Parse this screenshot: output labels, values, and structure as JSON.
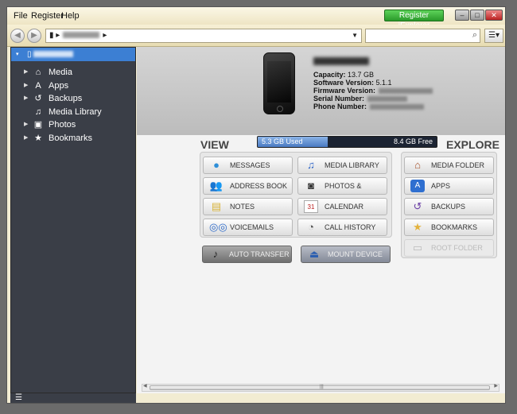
{
  "menu": {
    "file": "File",
    "register": "Register",
    "help": "Help"
  },
  "titlebar": {
    "register_button": "Register iExplorer",
    "minimize": "–",
    "maximize": "□",
    "close": "✕"
  },
  "toolbar": {
    "back": "◀",
    "forward": "▶",
    "search_placeholder": "",
    "search_icon": "⌕",
    "view_menu": "☰▾"
  },
  "sidebar": {
    "items": [
      {
        "label": "Media",
        "icon": "home-icon"
      },
      {
        "label": "Apps",
        "icon": "apps-icon"
      },
      {
        "label": "Backups",
        "icon": "backup-icon"
      },
      {
        "label": "Media Library",
        "icon": "music-note-icon"
      },
      {
        "label": "Photos",
        "icon": "photo-icon"
      },
      {
        "label": "Bookmarks",
        "icon": "star-icon"
      }
    ],
    "footer_icon": "☰"
  },
  "device": {
    "capacity_label": "Capacity:",
    "capacity_value": "13.7 GB",
    "software_label": "Software Version:",
    "software_value": "5.1.1",
    "firmware_label": "Firmware Version:",
    "serial_label": "Serial Number:",
    "phone_label": "Phone Number:"
  },
  "storage": {
    "used": "5.3 GB Used",
    "free": "8.4 GB Free",
    "used_fraction": 0.39
  },
  "sections": {
    "view": "VIEW",
    "explore": "EXPLORE"
  },
  "view_buttons": {
    "messages": "Messages",
    "address_book": "Address Book",
    "notes": "Notes",
    "voicemails": "Voicemails",
    "media_library": "Media Library",
    "photos_videos": "Photos & Videos",
    "calendar": "Calendar",
    "call_history": "Call History",
    "auto_transfer": "Auto Transfer",
    "mount_device": "Mount Device"
  },
  "explore_buttons": {
    "media_folder": "Media Folder",
    "apps": "Apps",
    "backups": "Backups",
    "bookmarks": "Bookmarks",
    "root_folder": "Root Folder"
  },
  "calendar_day": "31"
}
